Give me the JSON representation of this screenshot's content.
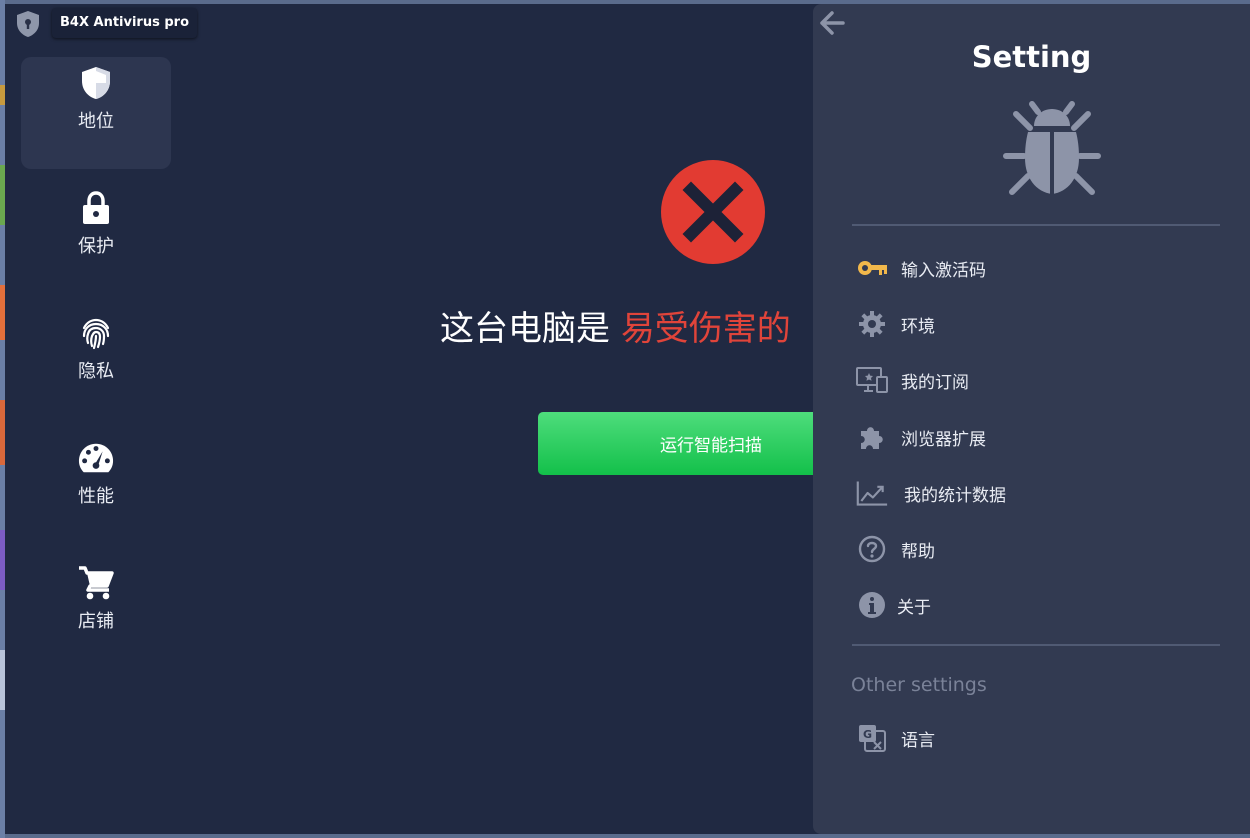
{
  "app": {
    "title": "B4X Antivirus pro"
  },
  "sidebar": {
    "items": [
      {
        "label": "地位",
        "icon": "shield-icon",
        "active": true
      },
      {
        "label": "保护",
        "icon": "lock-icon",
        "active": false
      },
      {
        "label": "隐私",
        "icon": "fingerprint-icon",
        "active": false
      },
      {
        "label": "性能",
        "icon": "speedometer-icon",
        "active": false
      },
      {
        "label": "店铺",
        "icon": "cart-icon",
        "active": false
      }
    ]
  },
  "main": {
    "headline_prefix": "这台电脑是",
    "headline_status": "易受伤害的",
    "scan_button_label": "运行智能扫描",
    "status_color": "#e0443a",
    "button_color": "#13c04a"
  },
  "settings": {
    "title": "Setting",
    "items": [
      {
        "label": "输入激活码",
        "icon": "key-icon"
      },
      {
        "label": "环境",
        "icon": "gear-icon"
      },
      {
        "label": "我的订阅",
        "icon": "devices-icon"
      },
      {
        "label": "浏览器扩展",
        "icon": "puzzle-icon"
      },
      {
        "label": "我的统计数据",
        "icon": "chart-line-icon"
      },
      {
        "label": "帮助",
        "icon": "help-icon"
      },
      {
        "label": "关于",
        "icon": "info-icon"
      }
    ],
    "other_heading": "Other settings",
    "other_items": [
      {
        "label": "语言",
        "icon": "translate-icon"
      }
    ],
    "accent_color": "#f2b84b"
  }
}
